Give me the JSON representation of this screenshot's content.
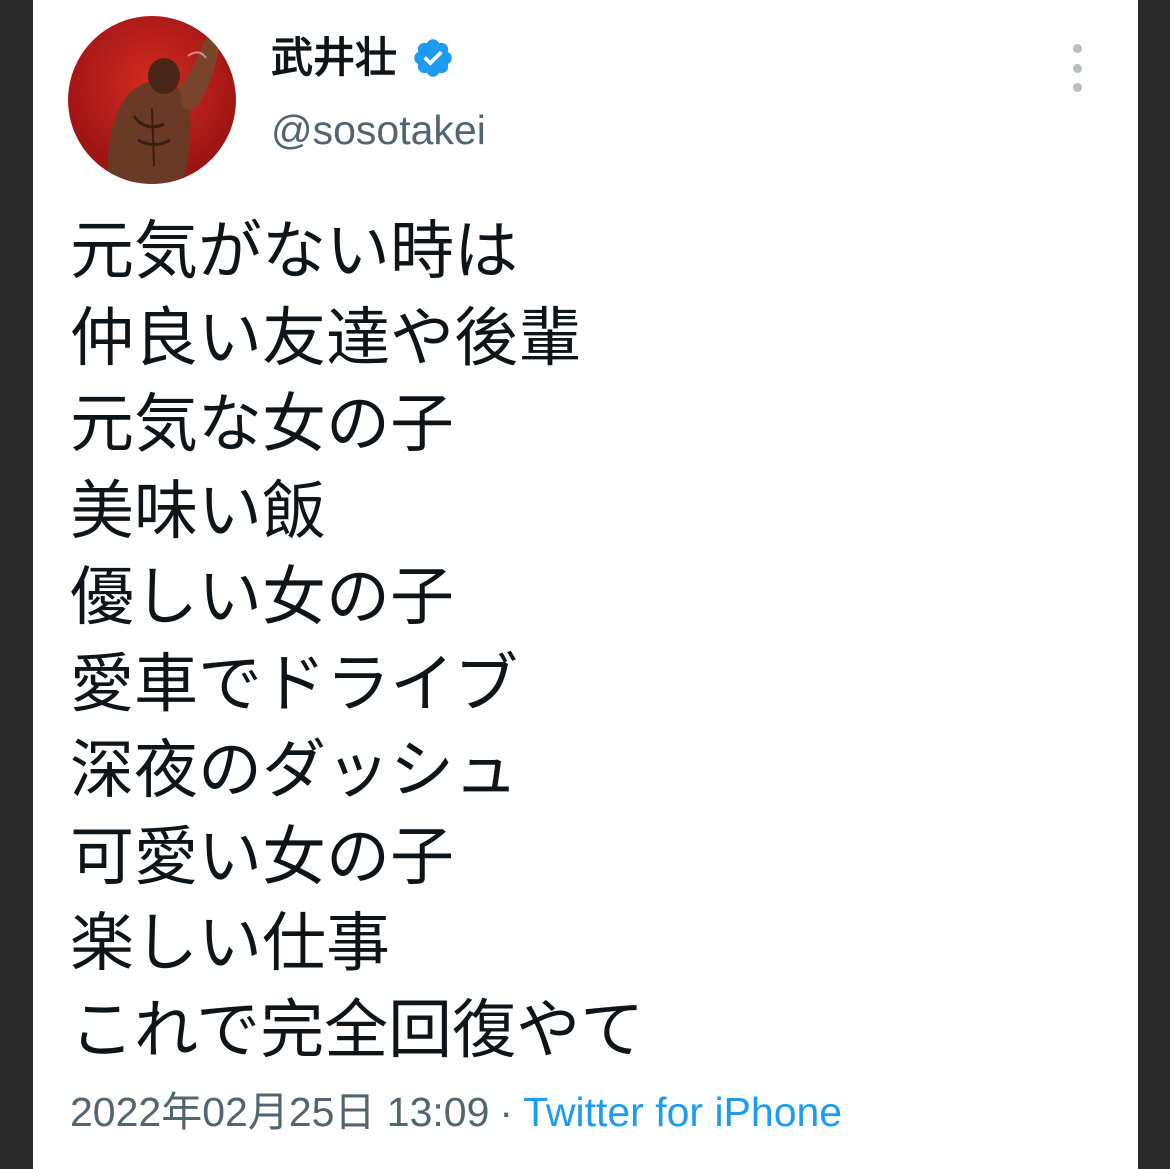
{
  "user": {
    "display_name": "武井壮",
    "handle": "@sosotakei",
    "verified": true,
    "verified_color": "#1d9bf0"
  },
  "tweet": {
    "lines": [
      "元気がない時は",
      "仲良い友達や後輩",
      "元気な女の子",
      "美味い飯",
      "優しい女の子",
      "愛車でドライブ",
      "深夜のダッシュ",
      "可愛い女の子",
      "楽しい仕事",
      "これで完全回復やて"
    ],
    "date": "2022年02月25日 13:09",
    "separator": "·",
    "source": "Twitter for iPhone"
  },
  "icons": {
    "more": "more-vertical-icon",
    "verified": "verified-badge-icon"
  },
  "colors": {
    "text_primary": "#0f1419",
    "text_secondary": "#536471",
    "link": "#1d9bf0",
    "avatar_background": "#b51a1a"
  }
}
